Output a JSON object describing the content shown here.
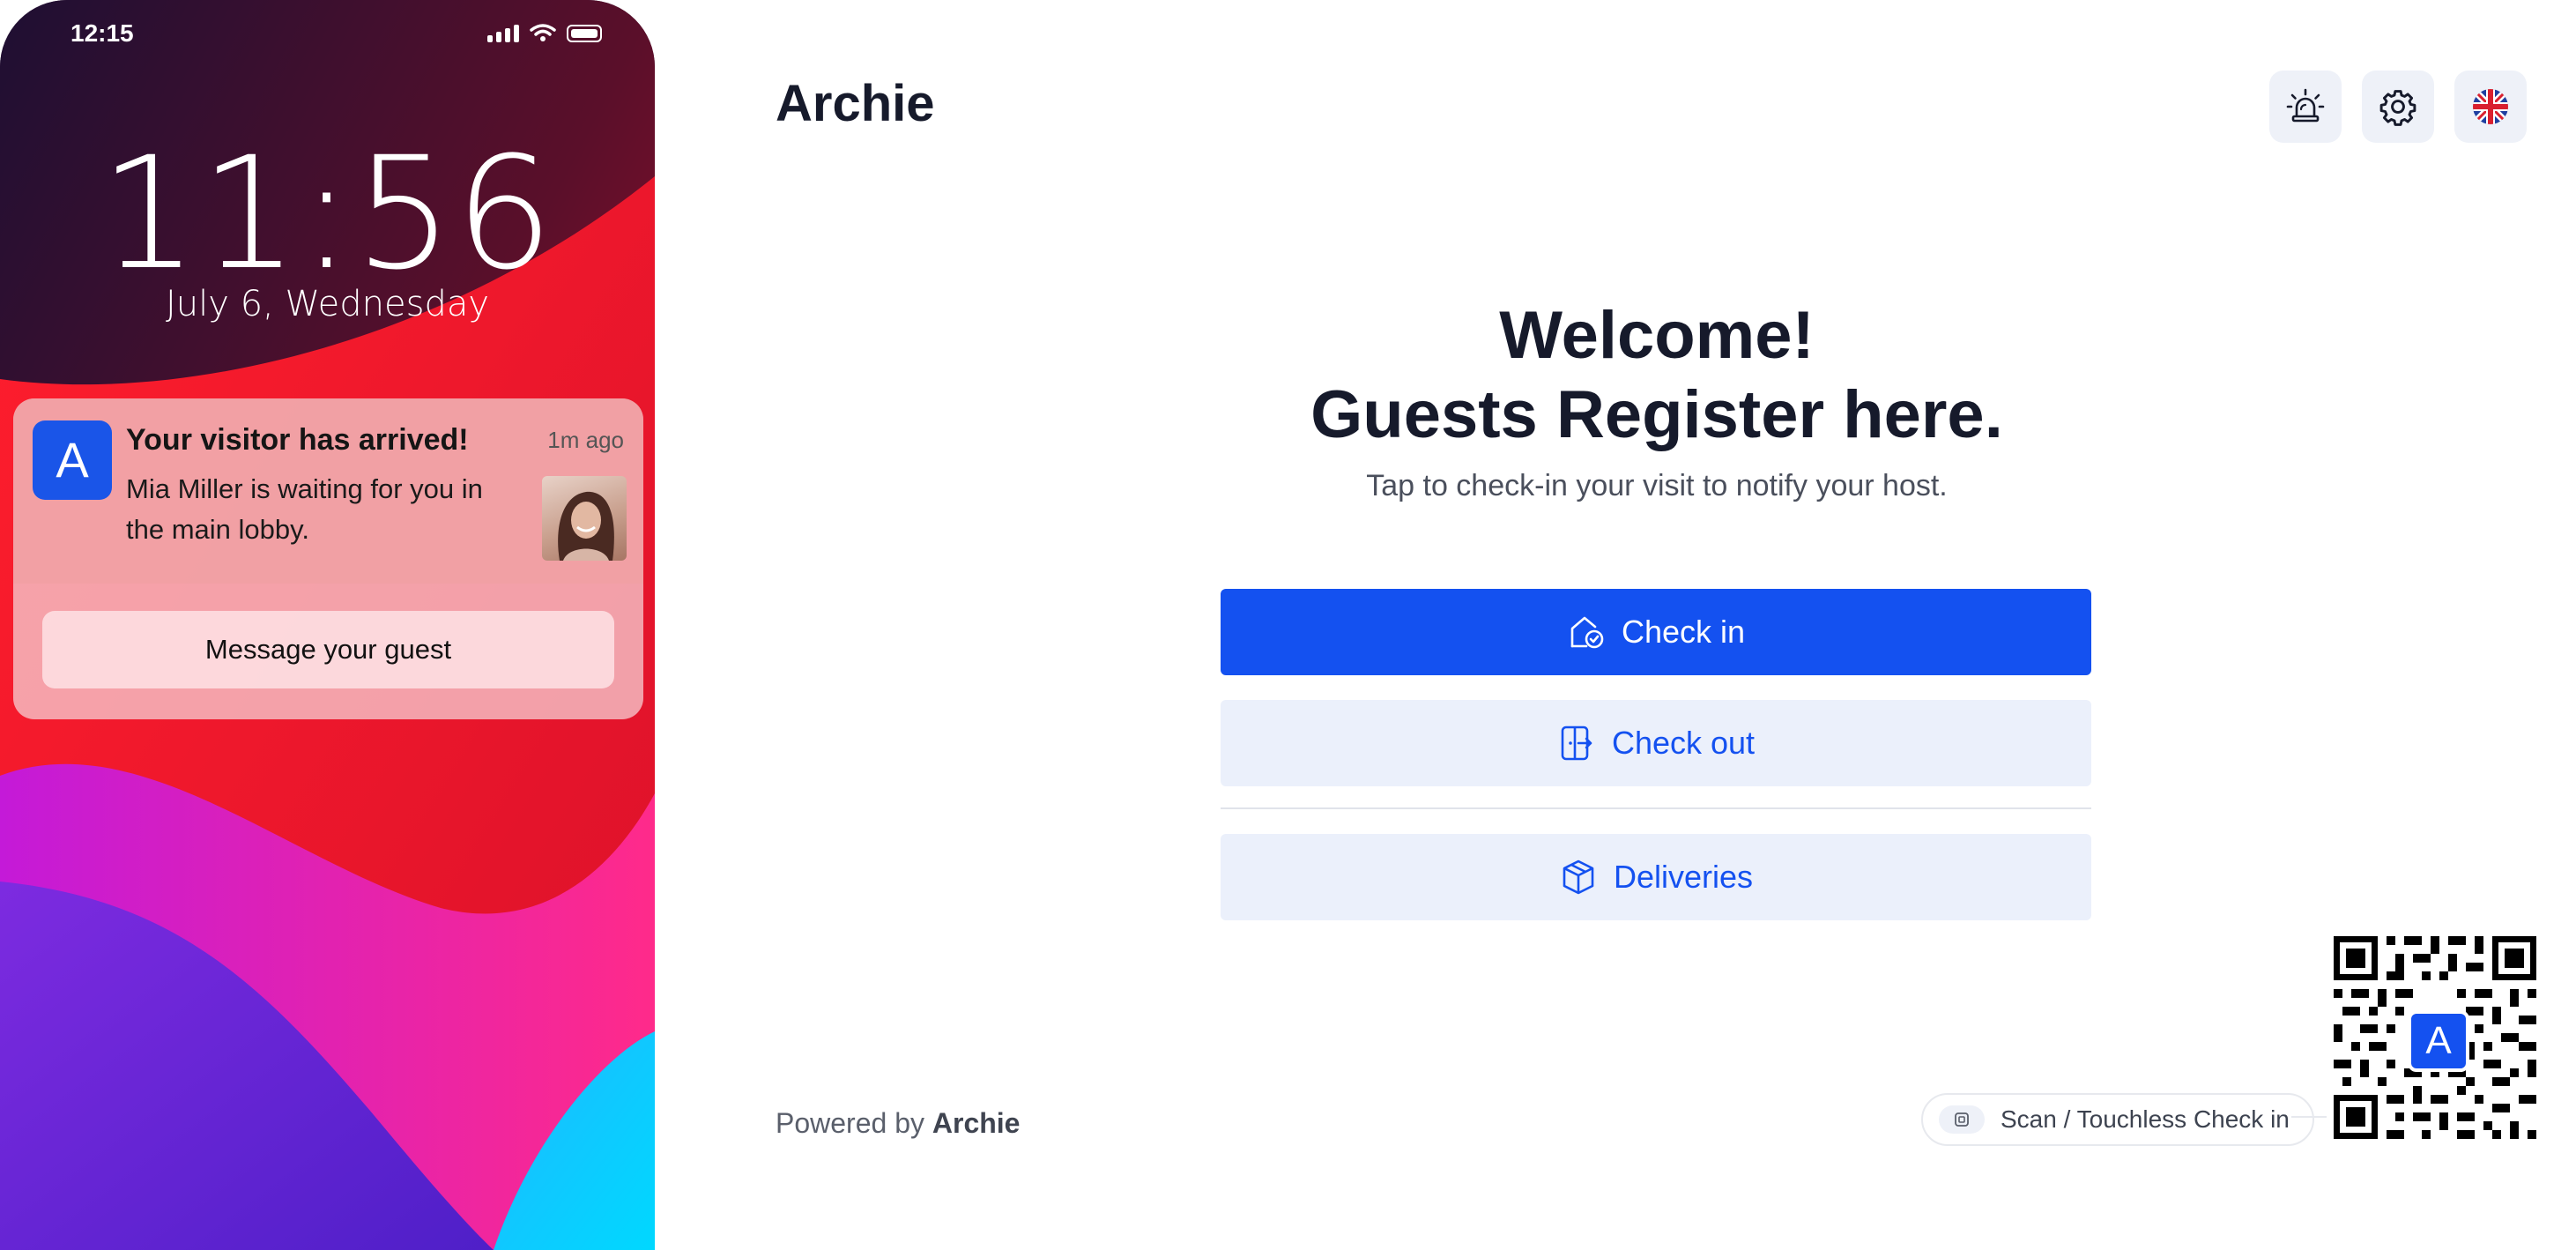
{
  "phone": {
    "status_time": "12:15",
    "lock_time": "11:56",
    "lock_date": "July 6, Wednesday",
    "notification": {
      "app_letter": "A",
      "title": "Your visitor has arrived!",
      "age": "1m ago",
      "body": "Mia Miller is waiting for you in the main lobby.",
      "action_label": "Message your guest"
    }
  },
  "kiosk": {
    "brand": "Archie",
    "header_buttons": [
      "alarm-icon",
      "gear-icon",
      "uk-flag-icon"
    ],
    "headline_line1": "Welcome!",
    "headline_line2": "Guests Register here.",
    "subtitle": "Tap to check-in your visit to notify your host.",
    "actions": {
      "check_in": "Check in",
      "check_out": "Check out",
      "deliveries": "Deliveries"
    },
    "footer": {
      "powered_prefix": "Powered by",
      "powered_brand": "Archie",
      "scan_label": "Scan / Touchless Check in",
      "qr_letter": "A"
    }
  },
  "colors": {
    "primary": "#1451f0",
    "secondary_bg": "#ebf0fb",
    "text_dark": "#161a2b"
  }
}
